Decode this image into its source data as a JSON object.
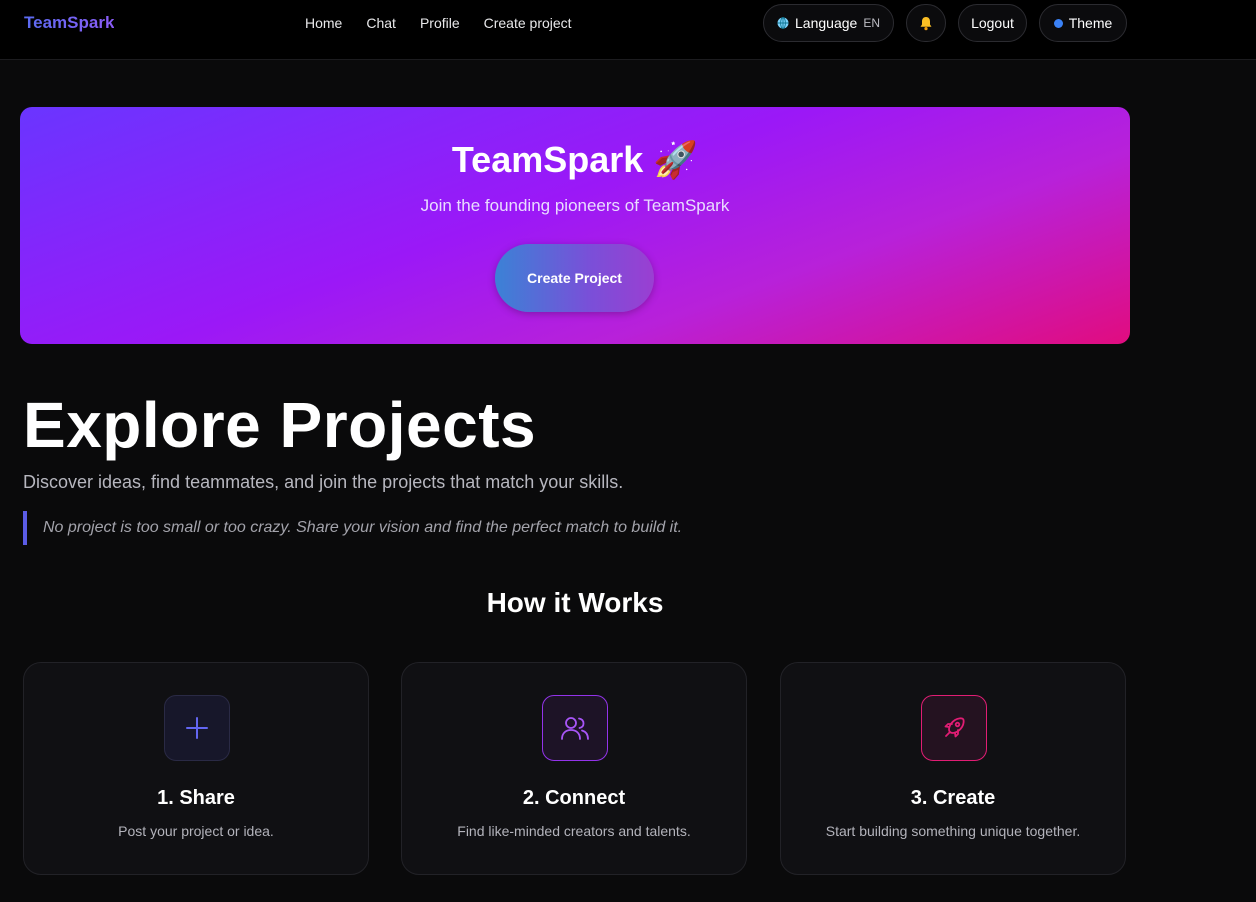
{
  "header": {
    "brand": "TeamSpark",
    "nav": [
      "Home",
      "Chat",
      "Profile",
      "Create project"
    ],
    "language_label": "Language",
    "language_code": "EN",
    "logout_label": "Logout",
    "theme_label": "Theme"
  },
  "hero": {
    "title": "TeamSpark 🚀",
    "subtitle": "Join the founding pioneers of TeamSpark",
    "button": "Create Project"
  },
  "explore": {
    "title": "Explore Projects",
    "description": "Discover ideas, find teammates, and join the projects that match your skills.",
    "quote": "No project is too small or too crazy. Share your vision and find the perfect match to build it."
  },
  "how": {
    "title": "How it Works",
    "steps": [
      {
        "title": "1. Share",
        "desc": "Post your project or idea.",
        "icon": "plus-icon"
      },
      {
        "title": "2. Connect",
        "desc": "Find like-minded creators and talents.",
        "icon": "users-icon"
      },
      {
        "title": "3. Create",
        "desc": "Start building something unique together.",
        "icon": "rocket-icon"
      }
    ]
  },
  "colors": {
    "accent_blue": "#5b6cf2",
    "accent_purple": "#9333ea",
    "accent_pink": "#e11d74",
    "hero_start": "#6a35ff",
    "hero_end": "#e10c7f"
  }
}
